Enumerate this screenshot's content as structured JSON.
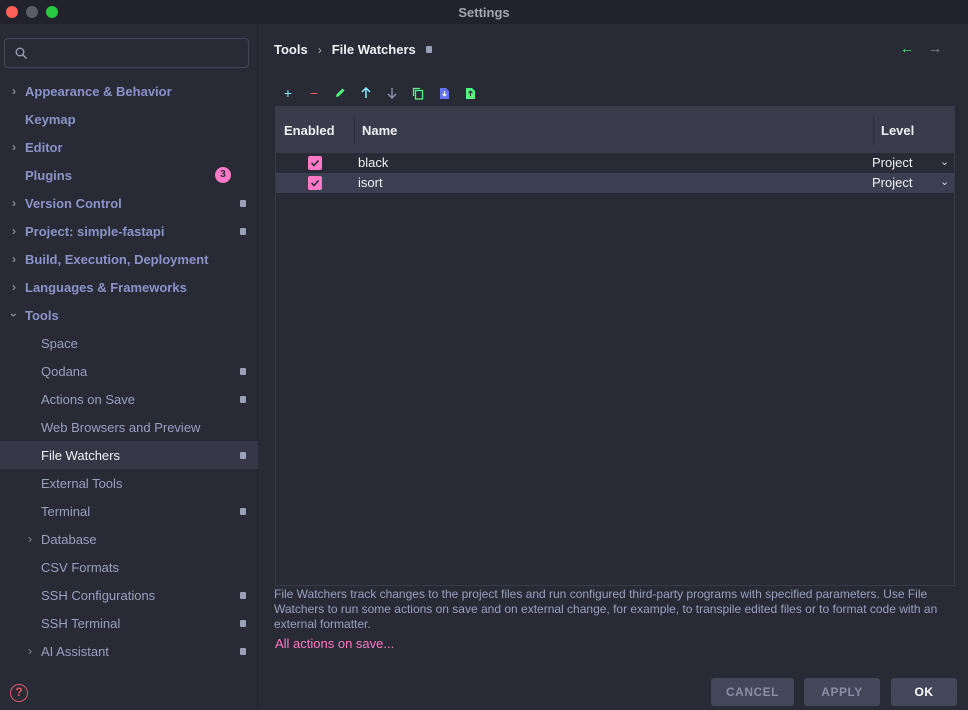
{
  "window": {
    "title": "Settings"
  },
  "sidebar": {
    "search_placeholder": "",
    "items": [
      {
        "label": "Appearance & Behavior",
        "level": 0,
        "expandable": true
      },
      {
        "label": "Keymap",
        "level": 0,
        "expandable": false
      },
      {
        "label": "Editor",
        "level": 0,
        "expandable": true
      },
      {
        "label": "Plugins",
        "level": 0,
        "expandable": false,
        "badge": "3"
      },
      {
        "label": "Version Control",
        "level": 0,
        "expandable": true,
        "project_icon": true
      },
      {
        "label": "Project: simple-fastapi",
        "level": 0,
        "expandable": true,
        "project_icon": true
      },
      {
        "label": "Build, Execution, Deployment",
        "level": 0,
        "expandable": true
      },
      {
        "label": "Languages & Frameworks",
        "level": 0,
        "expandable": true
      },
      {
        "label": "Tools",
        "level": 0,
        "expanded": true
      },
      {
        "label": "Space",
        "level": 1
      },
      {
        "label": "Qodana",
        "level": 1,
        "project_icon": true
      },
      {
        "label": "Actions on Save",
        "level": 1,
        "project_icon": true
      },
      {
        "label": "Web Browsers and Preview",
        "level": 1
      },
      {
        "label": "File Watchers",
        "level": 1,
        "project_icon": true,
        "selected": true
      },
      {
        "label": "External Tools",
        "level": 1
      },
      {
        "label": "Terminal",
        "level": 1,
        "project_icon": true
      },
      {
        "label": "Database",
        "level": 1,
        "expandable": true
      },
      {
        "label": "CSV Formats",
        "level": 1
      },
      {
        "label": "SSH Configurations",
        "level": 1,
        "project_icon": true
      },
      {
        "label": "SSH Terminal",
        "level": 1,
        "project_icon": true
      },
      {
        "label": "AI Assistant",
        "level": 1,
        "expandable": true,
        "project_icon": true
      }
    ]
  },
  "breadcrumb": {
    "parent": "Tools",
    "separator": "›",
    "current": "File Watchers"
  },
  "toolbar": {
    "icons": [
      "add-icon",
      "remove-icon",
      "edit-icon",
      "move-up-icon",
      "move-down-icon",
      "copy-icon",
      "import-icon",
      "export-icon"
    ]
  },
  "table": {
    "columns": [
      "Enabled",
      "Name",
      "Level"
    ],
    "rows": [
      {
        "enabled": true,
        "name": "black",
        "level": "Project"
      },
      {
        "enabled": true,
        "name": "isort",
        "level": "Project"
      }
    ]
  },
  "description": "File Watchers track changes to the project files and run configured third-party programs with specified parameters. Use File Watchers to run some actions on save and on external change, for example, to transpile edited files or to format code with an external formatter.",
  "link": "All actions on save...",
  "footer": {
    "cancel": "CANCEL",
    "apply": "APPLY",
    "ok": "OK"
  },
  "colors": {
    "accent": "#ff79c6",
    "background": "#282a36",
    "header": "#3a3c4b"
  }
}
